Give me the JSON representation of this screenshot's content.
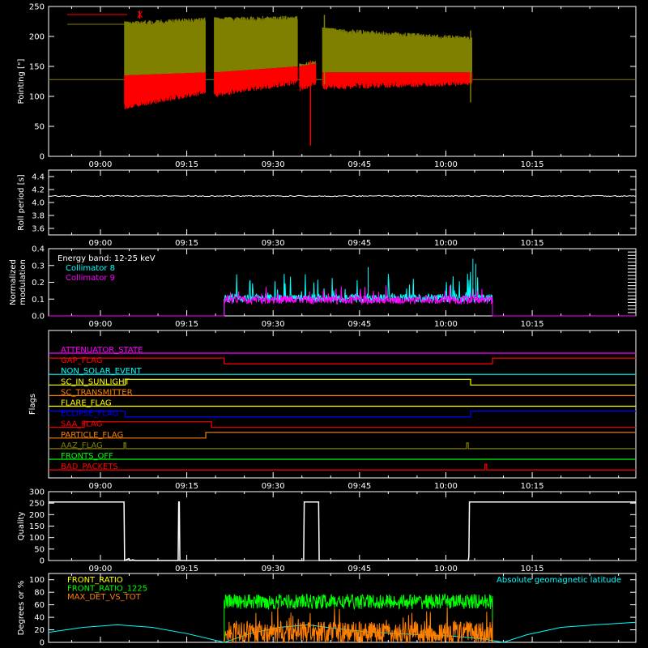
{
  "time_axis": {
    "tick_labels": [
      "09:00",
      "09:15",
      "09:30",
      "09:45",
      "10:00",
      "10:15"
    ],
    "tick_minutes": [
      540,
      555,
      570,
      585,
      600,
      615
    ],
    "range_minutes": [
      531,
      633
    ]
  },
  "colors": {
    "X": "#ff0000",
    "Y": "#808000",
    "white": "#ffffff",
    "cyan": "#00ffff",
    "magenta": "#ff00ff",
    "green": "#00ff00",
    "orange": "#ff8000",
    "yellow": "#ffff00",
    "blue": "#0000ff"
  },
  "chart_data": [
    {
      "id": "pointing",
      "type": "line",
      "ylabel": "Pointing [\"]",
      "ylim": [
        0,
        250
      ],
      "yticks": [
        0,
        50,
        100,
        150,
        200,
        250
      ],
      "legend": [
        {
          "name": "X",
          "color": "#ff0000"
        },
        {
          "name": "Y",
          "color": "#808000"
        }
      ],
      "reference_line": 128,
      "segments": [
        {
          "start": 544.2,
          "end": 558.2,
          "Y_top": [
            225,
            232
          ],
          "Y_bottom": [
            135,
            140
          ],
          "X_top": [
            135,
            140
          ],
          "X_bottom": [
            80,
            105
          ]
        },
        {
          "start": 559.8,
          "end": 574.2,
          "Y_top": [
            232,
            235
          ],
          "Y_bottom": [
            140,
            150
          ],
          "X_top": [
            140,
            150
          ],
          "X_bottom": [
            100,
            122
          ]
        },
        {
          "start": 574.6,
          "end": 577.4,
          "Y_top": [
            155,
            160
          ],
          "Y_bottom": [
            150,
            155
          ],
          "X_top": [
            150,
            155
          ],
          "X_bottom": [
            110,
            120
          ]
        },
        {
          "start": 578.6,
          "end": 604.5,
          "Y_top": [
            215,
            200
          ],
          "Y_bottom": [
            140,
            140
          ],
          "X_top": [
            140,
            140
          ],
          "X_bottom": [
            113,
            120
          ]
        }
      ],
      "spikes": [
        {
          "t": 576.5,
          "low": 18,
          "high": 160,
          "color": "#ff0000"
        },
        {
          "t": 546.8,
          "low": 230,
          "high": 243,
          "color": "#ff0000"
        },
        {
          "t": 578.9,
          "low": 236,
          "high": 120,
          "color": "#808000"
        },
        {
          "t": 604.3,
          "low": 90,
          "high": 210,
          "color": "#808000"
        }
      ]
    },
    {
      "id": "roll",
      "type": "line",
      "ylabel": "Roll period [s]",
      "ylim": [
        3.5,
        4.5
      ],
      "yticks": [
        3.6,
        3.8,
        4.0,
        4.2,
        4.4
      ],
      "baseline": 4.1,
      "x": [
        531,
        633
      ]
    },
    {
      "id": "modulation",
      "type": "line",
      "ylabel_lines": [
        "Normalized",
        "modulation"
      ],
      "ylim": [
        0,
        0.4
      ],
      "yticks": [
        0.0,
        0.1,
        0.2,
        0.3,
        0.4
      ],
      "annotation": "Energy band: 12-25 keV",
      "series": [
        {
          "name": "Collimator 8",
          "color": "#00ffff",
          "start": 561.5,
          "end": 608.1,
          "base": 0.1,
          "peak": 0.34
        },
        {
          "name": "Collimator 9",
          "color": "#ff00ff",
          "start": 561.5,
          "end": 608.1,
          "base": 0.09,
          "peak": 0.22
        }
      ]
    },
    {
      "id": "flags",
      "type": "line",
      "ylabel": "Flags",
      "series": [
        {
          "name": "ATTENUATOR_STATE",
          "color": "#ff00ff",
          "levels": [
            [
              531,
              0
            ]
          ]
        },
        {
          "name": "GAP_FLAG",
          "color": "#ff0000",
          "levels": [
            [
              531,
              1
            ],
            [
              561.5,
              0
            ],
            [
              608.1,
              1
            ]
          ]
        },
        {
          "name": "NON_SOLAR_EVENT",
          "color": "#00ffff",
          "levels": [
            [
              531,
              0
            ]
          ]
        },
        {
          "name": "SC_IN_SUNLIGHT",
          "color": "#ffff00",
          "levels": [
            [
              531,
              0
            ],
            [
              544.3,
              1
            ],
            [
              604.3,
              0
            ]
          ]
        },
        {
          "name": "SC_TRANSMITTER",
          "color": "#ff8000",
          "levels": [
            [
              531,
              0
            ]
          ]
        },
        {
          "name": "FLARE_FLAG",
          "color": "#ffff00",
          "levels": [
            [
              531,
              0
            ]
          ]
        },
        {
          "name": "ECLIPSE_FLAG",
          "color": "#0000ff",
          "levels": [
            [
              531,
              1
            ],
            [
              544.3,
              0
            ],
            [
              604.3,
              1
            ]
          ]
        },
        {
          "name": "SAA_FLAG",
          "color": "#ff0000",
          "levels": [
            [
              531,
              0
            ],
            [
              537.2,
              1
            ],
            [
              559.3,
              0
            ]
          ]
        },
        {
          "name": "PARTICLE_FLAG",
          "color": "#ff8000",
          "levels": [
            [
              531,
              0
            ],
            [
              558.3,
              1
            ]
          ]
        },
        {
          "name": "AAZ_FLAG",
          "color": "#808000",
          "levels": [
            [
              531,
              0
            ],
            [
              544.1,
              1
            ],
            [
              544.4,
              0
            ],
            [
              603.6,
              1
            ],
            [
              603.9,
              0
            ]
          ]
        },
        {
          "name": "FRONTS_OFF",
          "color": "#00ff00",
          "levels": [
            [
              531,
              0
            ]
          ]
        },
        {
          "name": "BAD_PACKETS",
          "color": "#ff0000",
          "levels": [
            [
              531,
              0
            ],
            [
              606.8,
              1
            ],
            [
              607.1,
              0
            ]
          ]
        }
      ]
    },
    {
      "id": "quality",
      "type": "line",
      "ylabel": "Quality",
      "ylim": [
        0,
        300
      ],
      "yticks": [
        0,
        50,
        100,
        150,
        200,
        250,
        300
      ],
      "x": [
        531,
        544.1,
        544.2,
        544.9,
        545.2,
        545.6,
        546.1,
        553.5,
        553.6,
        553.7,
        553.8,
        575.3,
        575.4,
        577.9,
        578.0,
        603.9,
        604.0,
        604.1,
        633
      ],
      "y": [
        255,
        255,
        0,
        8,
        0,
        3,
        0,
        0,
        255,
        255,
        0,
        0,
        255,
        255,
        0,
        0,
        20,
        255,
        255
      ]
    },
    {
      "id": "ratios",
      "type": "line",
      "ylabel": "Degrees or %",
      "ylim": [
        0,
        110
      ],
      "yticks": [
        0,
        20,
        40,
        60,
        80,
        100
      ],
      "annotation": "Absolute geomagnetic latitude",
      "series": [
        {
          "name": "FRONT_RATIO",
          "color": "#ffff00"
        },
        {
          "name": "FRONT_RATIO_1225",
          "color": "#00ff00",
          "start": 561.5,
          "end": 608.1,
          "base": 65,
          "amp": 12
        },
        {
          "name": "MAX_DET_VS_TOT",
          "color": "#ff8000",
          "start": 561.5,
          "end": 608.1,
          "base": 15,
          "amp": 18
        }
      ],
      "latitude": {
        "color": "#00ffff",
        "x": [
          531,
          537,
          543,
          549,
          555,
          561.5,
          566,
          571,
          576,
          581,
          586,
          591,
          596,
          601,
          606,
          610,
          614,
          620,
          626,
          633
        ],
        "y": [
          16,
          24,
          28,
          24,
          14,
          0,
          14,
          24,
          28,
          22,
          17,
          14,
          12,
          10,
          6,
          0,
          12,
          24,
          28,
          32
        ]
      }
    }
  ]
}
